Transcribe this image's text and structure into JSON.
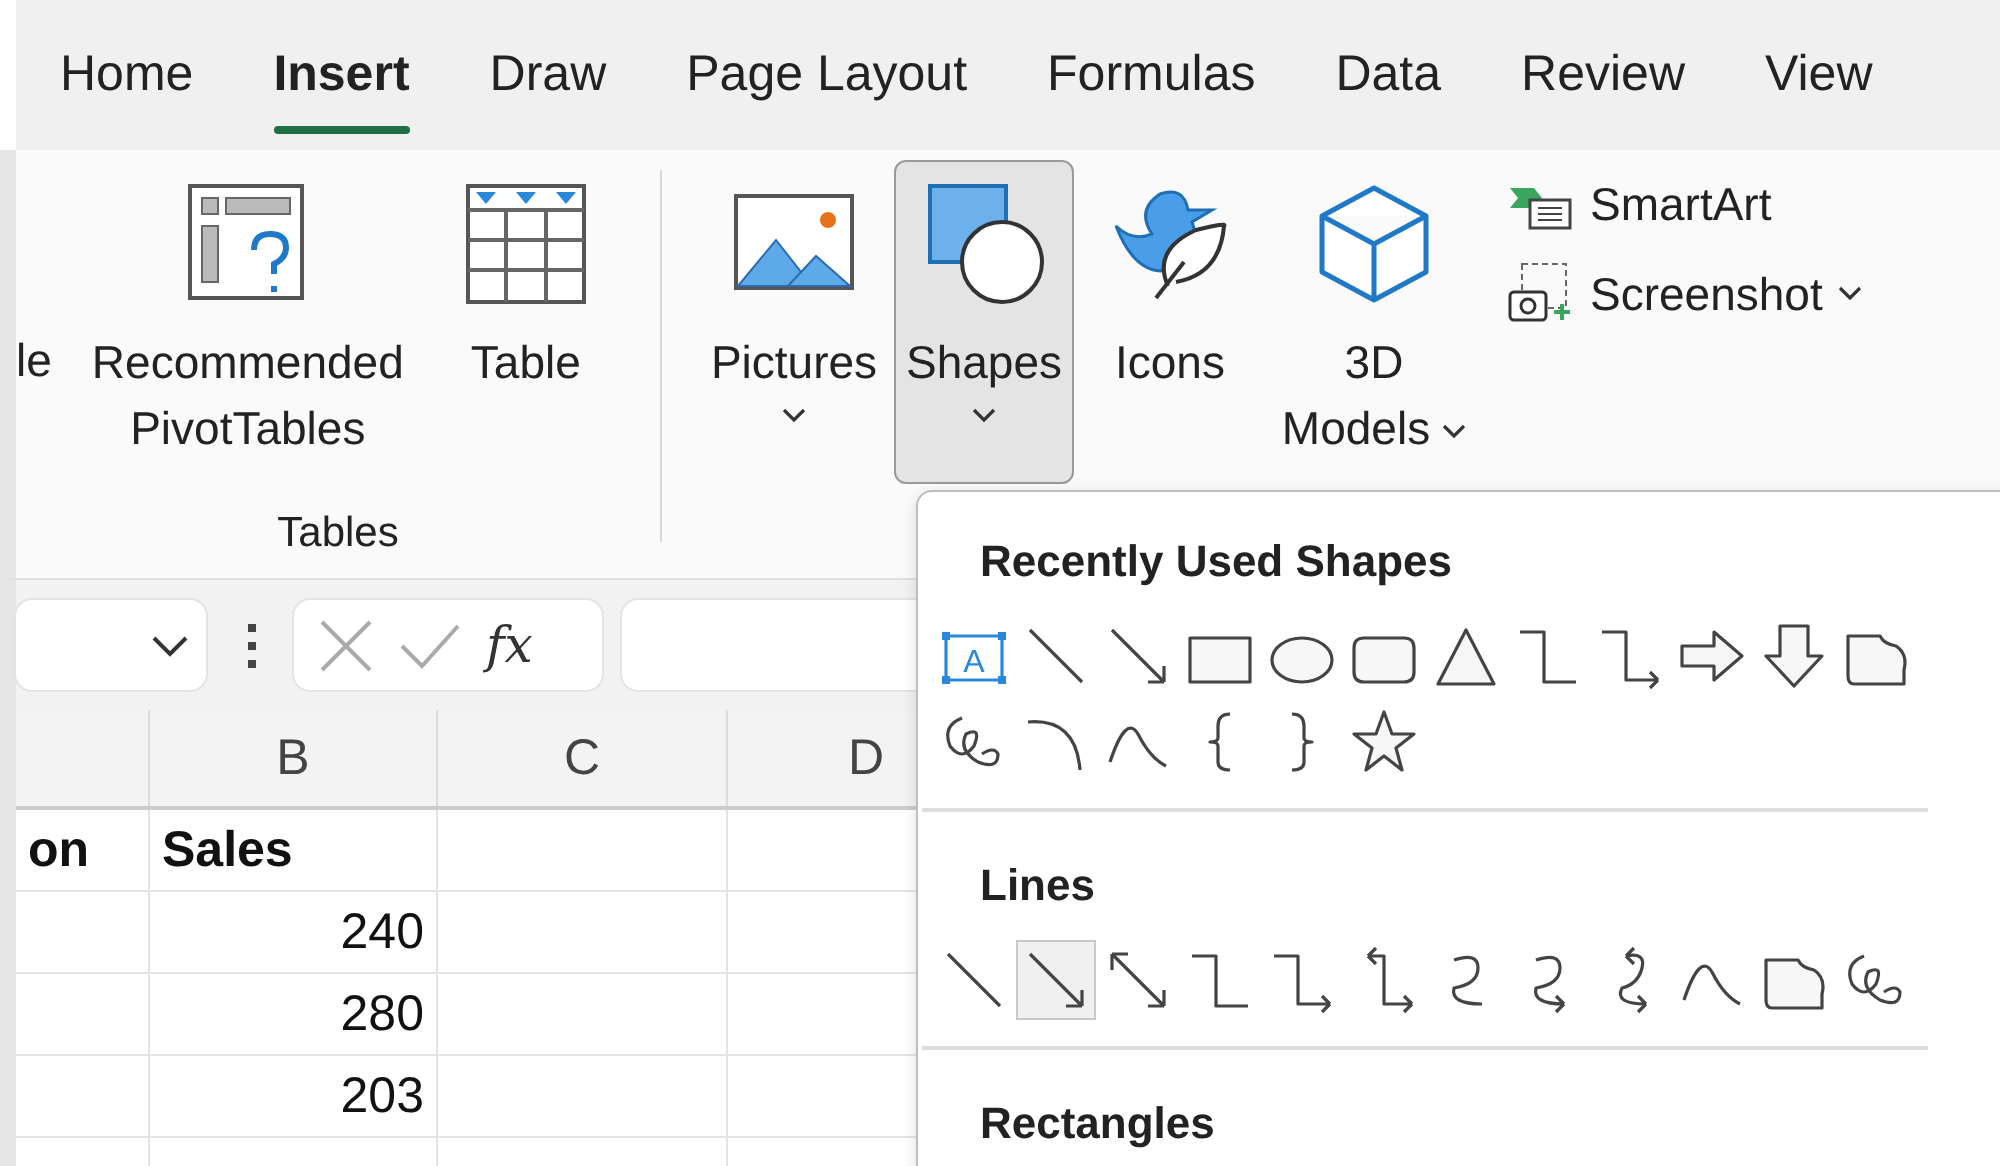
{
  "tabs": [
    {
      "label": "Home",
      "selected": false
    },
    {
      "label": "Insert",
      "selected": true
    },
    {
      "label": "Draw",
      "selected": false
    },
    {
      "label": "Page Layout",
      "selected": false
    },
    {
      "label": "Formulas",
      "selected": false
    },
    {
      "label": "Data",
      "selected": false
    },
    {
      "label": "Review",
      "selected": false
    },
    {
      "label": "View",
      "selected": false
    }
  ],
  "ribbon": {
    "tables_group": {
      "label": "Tables",
      "items": [
        {
          "kind": "cut",
          "label": "le"
        },
        {
          "kind": "pivot",
          "label": "Recommended PivotTables"
        },
        {
          "kind": "table",
          "label": "Table"
        }
      ]
    },
    "illustrations": [
      {
        "kind": "pictures",
        "label": "Pictures",
        "has_menu": true,
        "selected": false
      },
      {
        "kind": "shapes",
        "label": "Shapes",
        "has_menu": true,
        "selected": true
      },
      {
        "kind": "icons",
        "label": "Icons",
        "has_menu": false,
        "selected": false
      },
      {
        "kind": "models",
        "label": "3D Models",
        "has_menu": true,
        "selected": false
      }
    ],
    "small_buttons": [
      {
        "kind": "smartart",
        "label": "SmartArt",
        "has_menu": false
      },
      {
        "kind": "screenshot",
        "label": "Screenshot",
        "has_menu": true
      }
    ]
  },
  "formula_bar": {
    "fx": "fx"
  },
  "sheet": {
    "columns": [
      "B",
      "C",
      "D"
    ],
    "rows": [
      [
        "on",
        "Sales"
      ],
      [
        "",
        "240"
      ],
      [
        "",
        "280"
      ],
      [
        "",
        "203"
      ]
    ]
  },
  "shapes_menu": {
    "sections": [
      {
        "title": "Recently Used Shapes",
        "shapes": [
          {
            "kind": "textbox",
            "glyph": "A",
            "selected": false
          },
          {
            "kind": "line",
            "selected": false
          },
          {
            "kind": "arrow",
            "selected": false
          },
          {
            "kind": "rectangle",
            "selected": false
          },
          {
            "kind": "oval",
            "selected": false
          },
          {
            "kind": "rounded",
            "selected": false
          },
          {
            "kind": "triangle",
            "selected": false
          },
          {
            "kind": "elbow",
            "selected": false
          },
          {
            "kind": "elbow-arrow",
            "selected": false
          },
          {
            "kind": "block-right",
            "selected": false
          },
          {
            "kind": "block-down",
            "selected": false
          },
          {
            "kind": "freeform",
            "selected": false
          },
          {
            "kind": "scribble",
            "selected": false
          },
          {
            "kind": "arc",
            "selected": false
          },
          {
            "kind": "curve",
            "selected": false
          },
          {
            "kind": "left-brace",
            "selected": false
          },
          {
            "kind": "right-brace",
            "selected": false
          },
          {
            "kind": "star",
            "selected": false
          }
        ]
      },
      {
        "title": "Lines",
        "shapes": [
          {
            "kind": "line",
            "selected": false
          },
          {
            "kind": "arrow",
            "selected": true
          },
          {
            "kind": "double-arrow",
            "selected": false
          },
          {
            "kind": "elbow",
            "selected": false
          },
          {
            "kind": "elbow-arrow",
            "selected": false
          },
          {
            "kind": "elbow-double",
            "selected": false
          },
          {
            "kind": "curved",
            "selected": false
          },
          {
            "kind": "curved-arrow",
            "selected": false
          },
          {
            "kind": "curved-double",
            "selected": false
          },
          {
            "kind": "curve",
            "selected": false
          },
          {
            "kind": "freeform",
            "selected": false
          },
          {
            "kind": "scribble",
            "selected": false
          }
        ]
      },
      {
        "title": "Rectangles"
      }
    ]
  }
}
